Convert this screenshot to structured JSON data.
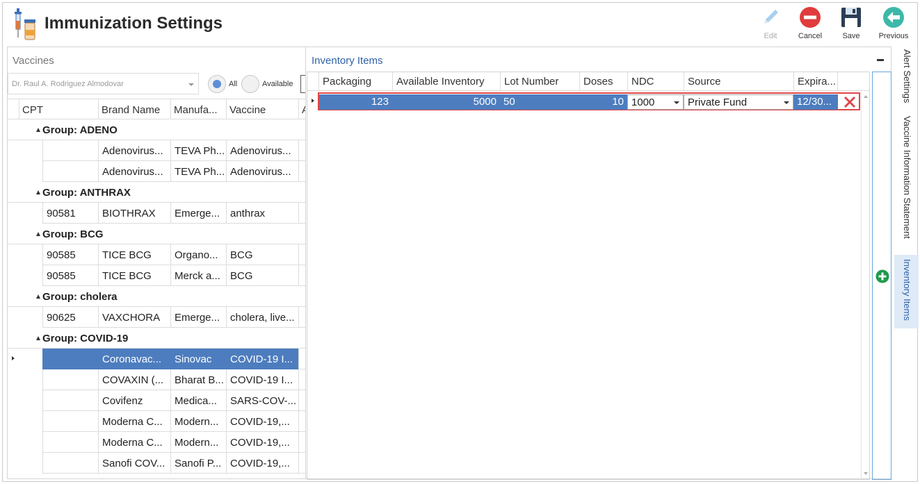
{
  "header": {
    "title": "Immunization Settings",
    "toolbar": [
      {
        "label": "Edit",
        "icon": "pencil-icon",
        "enabled": false
      },
      {
        "label": "Cancel",
        "icon": "cancel-icon",
        "enabled": true
      },
      {
        "label": "Save",
        "icon": "floppy-disk-icon",
        "enabled": true
      },
      {
        "label": "Previous",
        "icon": "arrow-left-icon",
        "enabled": true
      }
    ]
  },
  "vaccines": {
    "title": "Vaccines",
    "provider": "Dr. Raul A. Rodriguez Almodovar",
    "filter": {
      "all_label": "All",
      "available_label": "Available",
      "selected": "All"
    },
    "columns": [
      "CPT",
      "Brand Name",
      "Manufa...",
      "Vaccine",
      "A"
    ],
    "groups": [
      {
        "label": "Group: ADENO",
        "rows": [
          {
            "cpt": "",
            "brand": "Adenovirus...",
            "manufacturer": "TEVA Ph...",
            "vaccine": "Adenovirus..."
          },
          {
            "cpt": "",
            "brand": "Adenovirus...",
            "manufacturer": "TEVA Ph...",
            "vaccine": "Adenovirus..."
          }
        ]
      },
      {
        "label": "Group: ANTHRAX",
        "rows": [
          {
            "cpt": "90581",
            "brand": "BIOTHRAX",
            "manufacturer": "Emerge...",
            "vaccine": "anthrax"
          }
        ]
      },
      {
        "label": "Group: BCG",
        "rows": [
          {
            "cpt": "90585",
            "brand": "TICE BCG",
            "manufacturer": "Organo...",
            "vaccine": "BCG"
          },
          {
            "cpt": "90585",
            "brand": "TICE BCG",
            "manufacturer": "Merck a...",
            "vaccine": "BCG"
          }
        ]
      },
      {
        "label": "Group: cholera",
        "rows": [
          {
            "cpt": "90625",
            "brand": "VAXCHORA",
            "manufacturer": "Emerge...",
            "vaccine": "cholera, live..."
          }
        ]
      },
      {
        "label": "Group: COVID-19",
        "rows": [
          {
            "cpt": "",
            "brand": "Coronavac...",
            "manufacturer": "Sinovac",
            "vaccine": "COVID-19 I...",
            "selected": true
          },
          {
            "cpt": "",
            "brand": "COVAXIN (...",
            "manufacturer": "Bharat B...",
            "vaccine": "COVID-19 I..."
          },
          {
            "cpt": "",
            "brand": "Covifenz",
            "manufacturer": "Medica...",
            "vaccine": "SARS-COV-..."
          },
          {
            "cpt": "",
            "brand": "Moderna C...",
            "manufacturer": "Modern...",
            "vaccine": "COVID-19,..."
          },
          {
            "cpt": "",
            "brand": "Moderna C...",
            "manufacturer": "Modern...",
            "vaccine": "COVID-19,..."
          },
          {
            "cpt": "",
            "brand": "Sanofi COV...",
            "manufacturer": "Sanofi P...",
            "vaccine": "COVID-19,..."
          }
        ]
      }
    ]
  },
  "inventory": {
    "title": "Inventory Items",
    "columns": [
      "Packaging",
      "Available Inventory",
      "Lot Number",
      "Doses",
      "NDC",
      "Source",
      "Expira..."
    ],
    "rows": [
      {
        "packaging": "123",
        "available": "5000",
        "lot": "50",
        "doses": "10",
        "ndc": "1000",
        "source": "Private Fund",
        "expiration": "12/30..."
      }
    ]
  },
  "side_tabs": [
    {
      "label": "Alert Settings",
      "active": false
    },
    {
      "label": "Vaccine Information Statement",
      "active": false
    },
    {
      "label": "Inventory Items",
      "active": true
    }
  ],
  "colors": {
    "selection": "#4d7dbf",
    "accent": "#2f62a8",
    "highlight_border": "#e0464a",
    "add": "#1e9a4a"
  }
}
